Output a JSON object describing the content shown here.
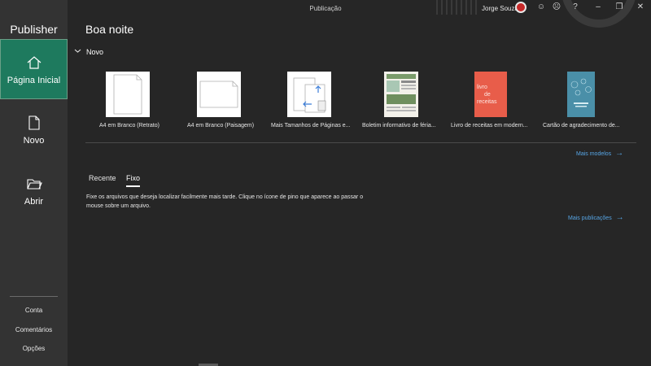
{
  "app": {
    "name": "Publisher",
    "document_title": "Publicação"
  },
  "titlebar": {
    "user_name": "Jorge Souza"
  },
  "sidebar": {
    "items": [
      {
        "label": "Página Inicial",
        "icon": "home-icon",
        "active": true
      },
      {
        "label": "Novo",
        "icon": "new-document-icon"
      },
      {
        "label": "Abrir",
        "icon": "folder-icon"
      }
    ],
    "bottom_links": [
      "Conta",
      "Comentários",
      "Opções"
    ]
  },
  "main": {
    "greeting": "Boa noite",
    "new_section": {
      "title": "Novo",
      "templates": [
        {
          "label": "A4 em Branco (Retrato)"
        },
        {
          "label": "A4 em Branco (Paisagem)"
        },
        {
          "label": "Mais Tamanhos de Páginas e..."
        },
        {
          "label": "Boletim informativo de féria..."
        },
        {
          "label": "Livro de receitas em modern..."
        },
        {
          "label": "Cartão de agradecimento de..."
        }
      ],
      "recipe_cover_text": [
        "livro",
        "de",
        "receitas"
      ],
      "more_templates": "Mais modelos"
    },
    "tabs": [
      {
        "label": "Recente",
        "active": false
      },
      {
        "label": "Fixo",
        "active": true
      }
    ],
    "pinned_help": "Fixe os arquivos que deseja localizar facilmente mais tarde. Clique no ícone de pino que aparece ao passar o mouse sobre um arquivo.",
    "more_publications": "Mais publicações"
  },
  "colors": {
    "accent_green": "#1e7a5e",
    "link_blue": "#57a6e6",
    "recipe_orange": "#e85d4a",
    "card_teal": "#4a8fa8"
  }
}
